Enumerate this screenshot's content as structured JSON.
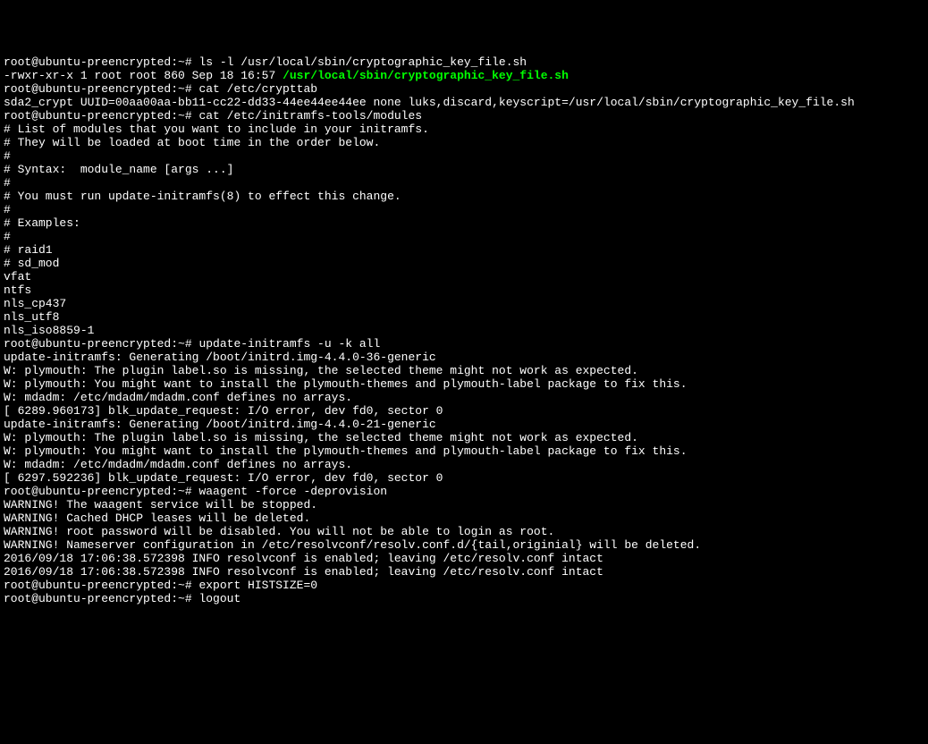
{
  "terminal": {
    "prompt": "root@ubuntu-preencrypted:~#",
    "lines": {
      "l1_prompt": "root@ubuntu-preencrypted:~# ",
      "l1_cmd": "ls -l /usr/local/sbin/cryptographic_key_file.sh",
      "l2_a": "-rwxr-xr-x 1 root root 860 Sep 18 16:57 ",
      "l2_b": "/usr/local/sbin/cryptographic_key_file.sh",
      "l3_prompt": "root@ubuntu-preencrypted:~# ",
      "l3_cmd": "cat /etc/crypttab",
      "l4": "sda2_crypt UUID=00aa00aa-bb11-cc22-dd33-44ee44ee44ee none luks,discard,keyscript=/usr/local/sbin/cryptographic_key_file.sh",
      "l5_prompt": "root@ubuntu-preencrypted:~# ",
      "l5_cmd": "cat /etc/initramfs-tools/modules",
      "l6": "# List of modules that you want to include in your initramfs.",
      "l7": "# They will be loaded at boot time in the order below.",
      "l8": "#",
      "l9": "# Syntax:  module_name [args ...]",
      "l10": "#",
      "l11": "# You must run update-initramfs(8) to effect this change.",
      "l12": "#",
      "l13": "# Examples:",
      "l14": "#",
      "l15": "# raid1",
      "l16": "# sd_mod",
      "l17": "vfat",
      "l18": "ntfs",
      "l19": "nls_cp437",
      "l20": "nls_utf8",
      "l21": "nls_iso8859-1",
      "l22_prompt": "root@ubuntu-preencrypted:~# ",
      "l22_cmd": "update-initramfs -u -k all",
      "l23": "update-initramfs: Generating /boot/initrd.img-4.4.0-36-generic",
      "l24": "W: plymouth: The plugin label.so is missing, the selected theme might not work as expected.",
      "l25": "W: plymouth: You might want to install the plymouth-themes and plymouth-label package to fix this.",
      "l26": "W: mdadm: /etc/mdadm/mdadm.conf defines no arrays.",
      "l27": "[ 6289.960173] blk_update_request: I/O error, dev fd0, sector 0",
      "l28": "update-initramfs: Generating /boot/initrd.img-4.4.0-21-generic",
      "l29": "W: plymouth: The plugin label.so is missing, the selected theme might not work as expected.",
      "l30": "W: plymouth: You might want to install the plymouth-themes and plymouth-label package to fix this.",
      "l31": "W: mdadm: /etc/mdadm/mdadm.conf defines no arrays.",
      "l32": "[ 6297.592236] blk_update_request: I/O error, dev fd0, sector 0",
      "l33_prompt": "root@ubuntu-preencrypted:~# ",
      "l33_cmd": "waagent -force -deprovision",
      "l34": "WARNING! The waagent service will be stopped.",
      "l35": "WARNING! Cached DHCP leases will be deleted.",
      "l36": "WARNING! root password will be disabled. You will not be able to login as root.",
      "l37": "WARNING! Nameserver configuration in /etc/resolvconf/resolv.conf.d/{tail,originial} will be deleted.",
      "l38": "2016/09/18 17:06:38.572398 INFO resolvconf is enabled; leaving /etc/resolv.conf intact",
      "l39": "2016/09/18 17:06:38.572398 INFO resolvconf is enabled; leaving /etc/resolv.conf intact",
      "l40_prompt": "root@ubuntu-preencrypted:~# ",
      "l40_cmd": "export HISTSIZE=0",
      "l41_prompt": "root@ubuntu-preencrypted:~# ",
      "l41_cmd": "logout"
    }
  }
}
